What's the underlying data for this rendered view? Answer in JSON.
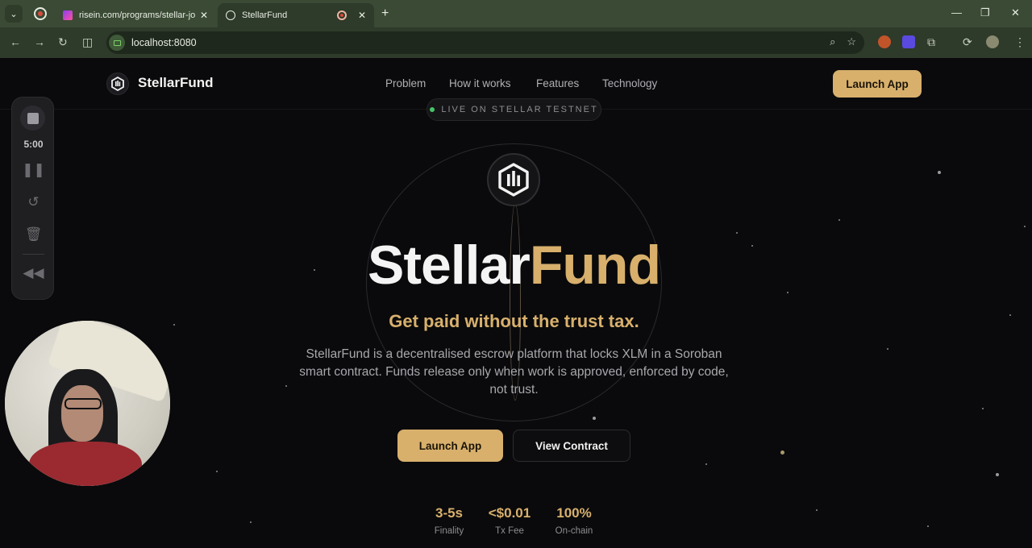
{
  "browser": {
    "tabs": [
      {
        "title": "risein.com/programs/stellar-jou"
      },
      {
        "title": "StellarFund"
      }
    ],
    "url": "localhost:8080"
  },
  "nav": {
    "brand": "StellarFund",
    "links": [
      "Problem",
      "How it works",
      "Features",
      "Technology"
    ],
    "launch": "Launch App"
  },
  "hero": {
    "badge": "LIVE ON STELLAR TESTNET",
    "title_white": "Stellar",
    "title_gold": "Fund",
    "tagline": "Get paid without the trust tax.",
    "description": "StellarFund is a decentralised escrow platform that locks XLM in a Soroban smart contract. Funds release only when work is approved, enforced by code, not trust.",
    "primary_button": "Launch App",
    "secondary_button": "View Contract"
  },
  "stats": [
    {
      "value": "3-5s",
      "label": "Finality"
    },
    {
      "value": "<$0.01",
      "label": "Tx Fee"
    },
    {
      "value": "100%",
      "label": "On-chain"
    }
  ],
  "recorder": {
    "time": "5:00"
  },
  "colors": {
    "accent": "#d8b06c",
    "background": "#0a0a0c",
    "chrome": "#3a4a34"
  }
}
